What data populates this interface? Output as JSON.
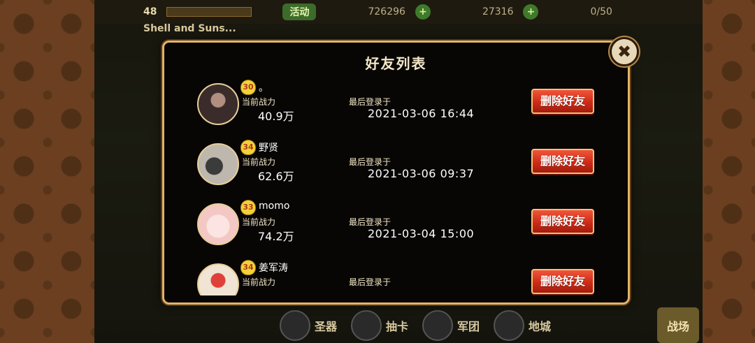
{
  "dialog": {
    "title": "好友列表",
    "delete_label": "删除好友",
    "power_label": "当前战力",
    "last_login_label": "最后登录于"
  },
  "friends": [
    {
      "level": "30",
      "name": "。",
      "power": "40.9万",
      "last_login": "2021-03-06  16:44",
      "avatar_color": "#3a2c2a"
    },
    {
      "level": "34",
      "name": "野贤",
      "power": "62.6万",
      "last_login": "2021-03-06  09:37",
      "avatar_color": "#bdb7ae"
    },
    {
      "level": "33",
      "name": "momo",
      "power": "74.2万",
      "last_login": "2021-03-04  15:00",
      "avatar_color": "#f3c7c4"
    },
    {
      "level": "34",
      "name": "姜军涛",
      "power": "",
      "last_login": "",
      "avatar_color": "#f0e4d4"
    }
  ],
  "background": {
    "player_level": "48",
    "event_label": "活动",
    "gold": "726296",
    "gems": "27316",
    "capacity": "0/50",
    "guild_name": "Shell and Suns...",
    "bottom_nav": [
      "圣器",
      "抽卡",
      "军团",
      "地城",
      "战场"
    ]
  },
  "colors": {
    "dialog_border": "#e2b46a",
    "delete_button": "#cc2b18",
    "badge": "#f2d23a"
  }
}
